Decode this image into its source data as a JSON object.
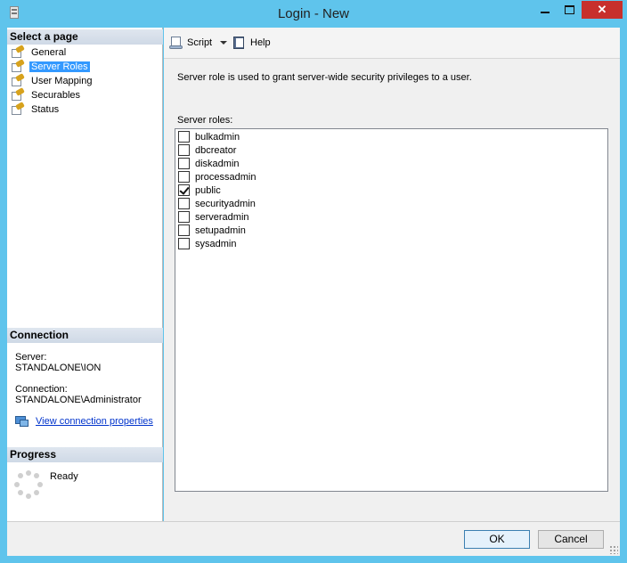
{
  "window": {
    "title": "Login - New",
    "close_glyph": "✕",
    "titlebar_color": "#5fc4ec"
  },
  "left_pane": {
    "select_page_heading": "Select a page",
    "pages": [
      {
        "label": "General",
        "selected": false
      },
      {
        "label": "Server Roles",
        "selected": true
      },
      {
        "label": "User Mapping",
        "selected": false
      },
      {
        "label": "Securables",
        "selected": false
      },
      {
        "label": "Status",
        "selected": false
      }
    ],
    "connection_heading": "Connection",
    "server_label": "Server:",
    "server_value": "STANDALONE\\ION",
    "connection_label": "Connection:",
    "connection_value": "STANDALONE\\Administrator",
    "view_connection_link": "View connection properties",
    "progress_heading": "Progress",
    "progress_status": "Ready"
  },
  "toolbar": {
    "script_label": "Script",
    "help_label": "Help"
  },
  "main": {
    "description": "Server role is used to grant server-wide security privileges to a user.",
    "roles_label": "Server roles:",
    "roles": [
      {
        "name": "bulkadmin",
        "checked": false
      },
      {
        "name": "dbcreator",
        "checked": false
      },
      {
        "name": "diskadmin",
        "checked": false
      },
      {
        "name": "processadmin",
        "checked": false
      },
      {
        "name": "public",
        "checked": true
      },
      {
        "name": "securityadmin",
        "checked": false
      },
      {
        "name": "serveradmin",
        "checked": false
      },
      {
        "name": "setupadmin",
        "checked": false
      },
      {
        "name": "sysadmin",
        "checked": false
      }
    ]
  },
  "footer": {
    "ok_label": "OK",
    "cancel_label": "Cancel"
  }
}
